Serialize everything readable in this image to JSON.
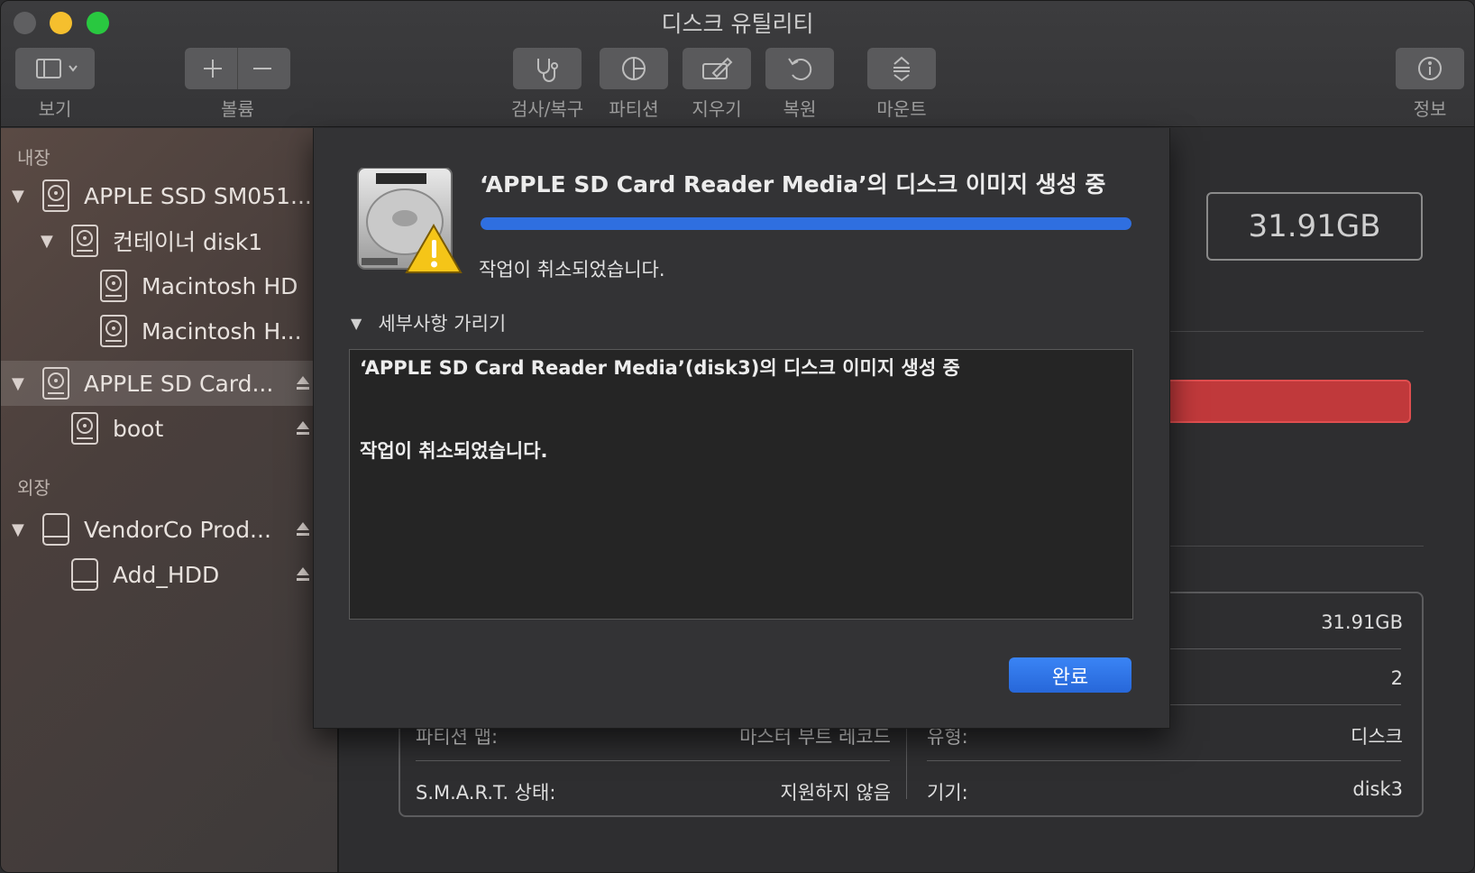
{
  "window": {
    "title": "디스크 유틸리티"
  },
  "toolbar": {
    "view_label": "보기",
    "volume_label": "볼륨",
    "firstaid_label": "검사/복구",
    "partition_label": "파티션",
    "erase_label": "지우기",
    "restore_label": "복원",
    "mount_label": "마운트",
    "info_label": "정보"
  },
  "sidebar": {
    "internal_header": "내장",
    "external_header": "외장",
    "items": [
      {
        "label": "APPLE SSD SM051..."
      },
      {
        "label": "컨테이너 disk1"
      },
      {
        "label": "Macintosh HD"
      },
      {
        "label": "Macintosh H..."
      },
      {
        "label": "APPLE SD Card..."
      },
      {
        "label": "boot"
      },
      {
        "label": "VendorCo Prod..."
      },
      {
        "label": "Add_HDD"
      }
    ]
  },
  "main": {
    "capacity": "31.91GB",
    "info": {
      "partition_map_label": "파티션 맵:",
      "partition_map_value": "마스터 부트 레코드",
      "smart_label": "S.M.A.R.T. 상태:",
      "smart_value": "지원하지 않음",
      "capacity_value": "31.91GB",
      "child_count_value": "2",
      "type_label": "유형:",
      "type_value": "디스크",
      "device_label": "기기:",
      "device_value": "disk3"
    }
  },
  "dialog": {
    "title": "‘APPLE SD Card Reader Media’의 디스크 이미지 생성 중",
    "progress_fraction": 1.0,
    "status": "작업이 취소되었습니다.",
    "details_toggle": "세부사항 가리기",
    "log_lines": [
      "‘APPLE SD Card Reader Media’(disk3)의 디스크 이미지 생성 중",
      "작업이 취소되었습니다."
    ],
    "done_button": "완료"
  },
  "colors": {
    "accent": "#2f6fe0",
    "close": "#5f5f61",
    "minimize": "#f5bf2e",
    "zoom": "#29c840",
    "warning": "#f5c518"
  }
}
